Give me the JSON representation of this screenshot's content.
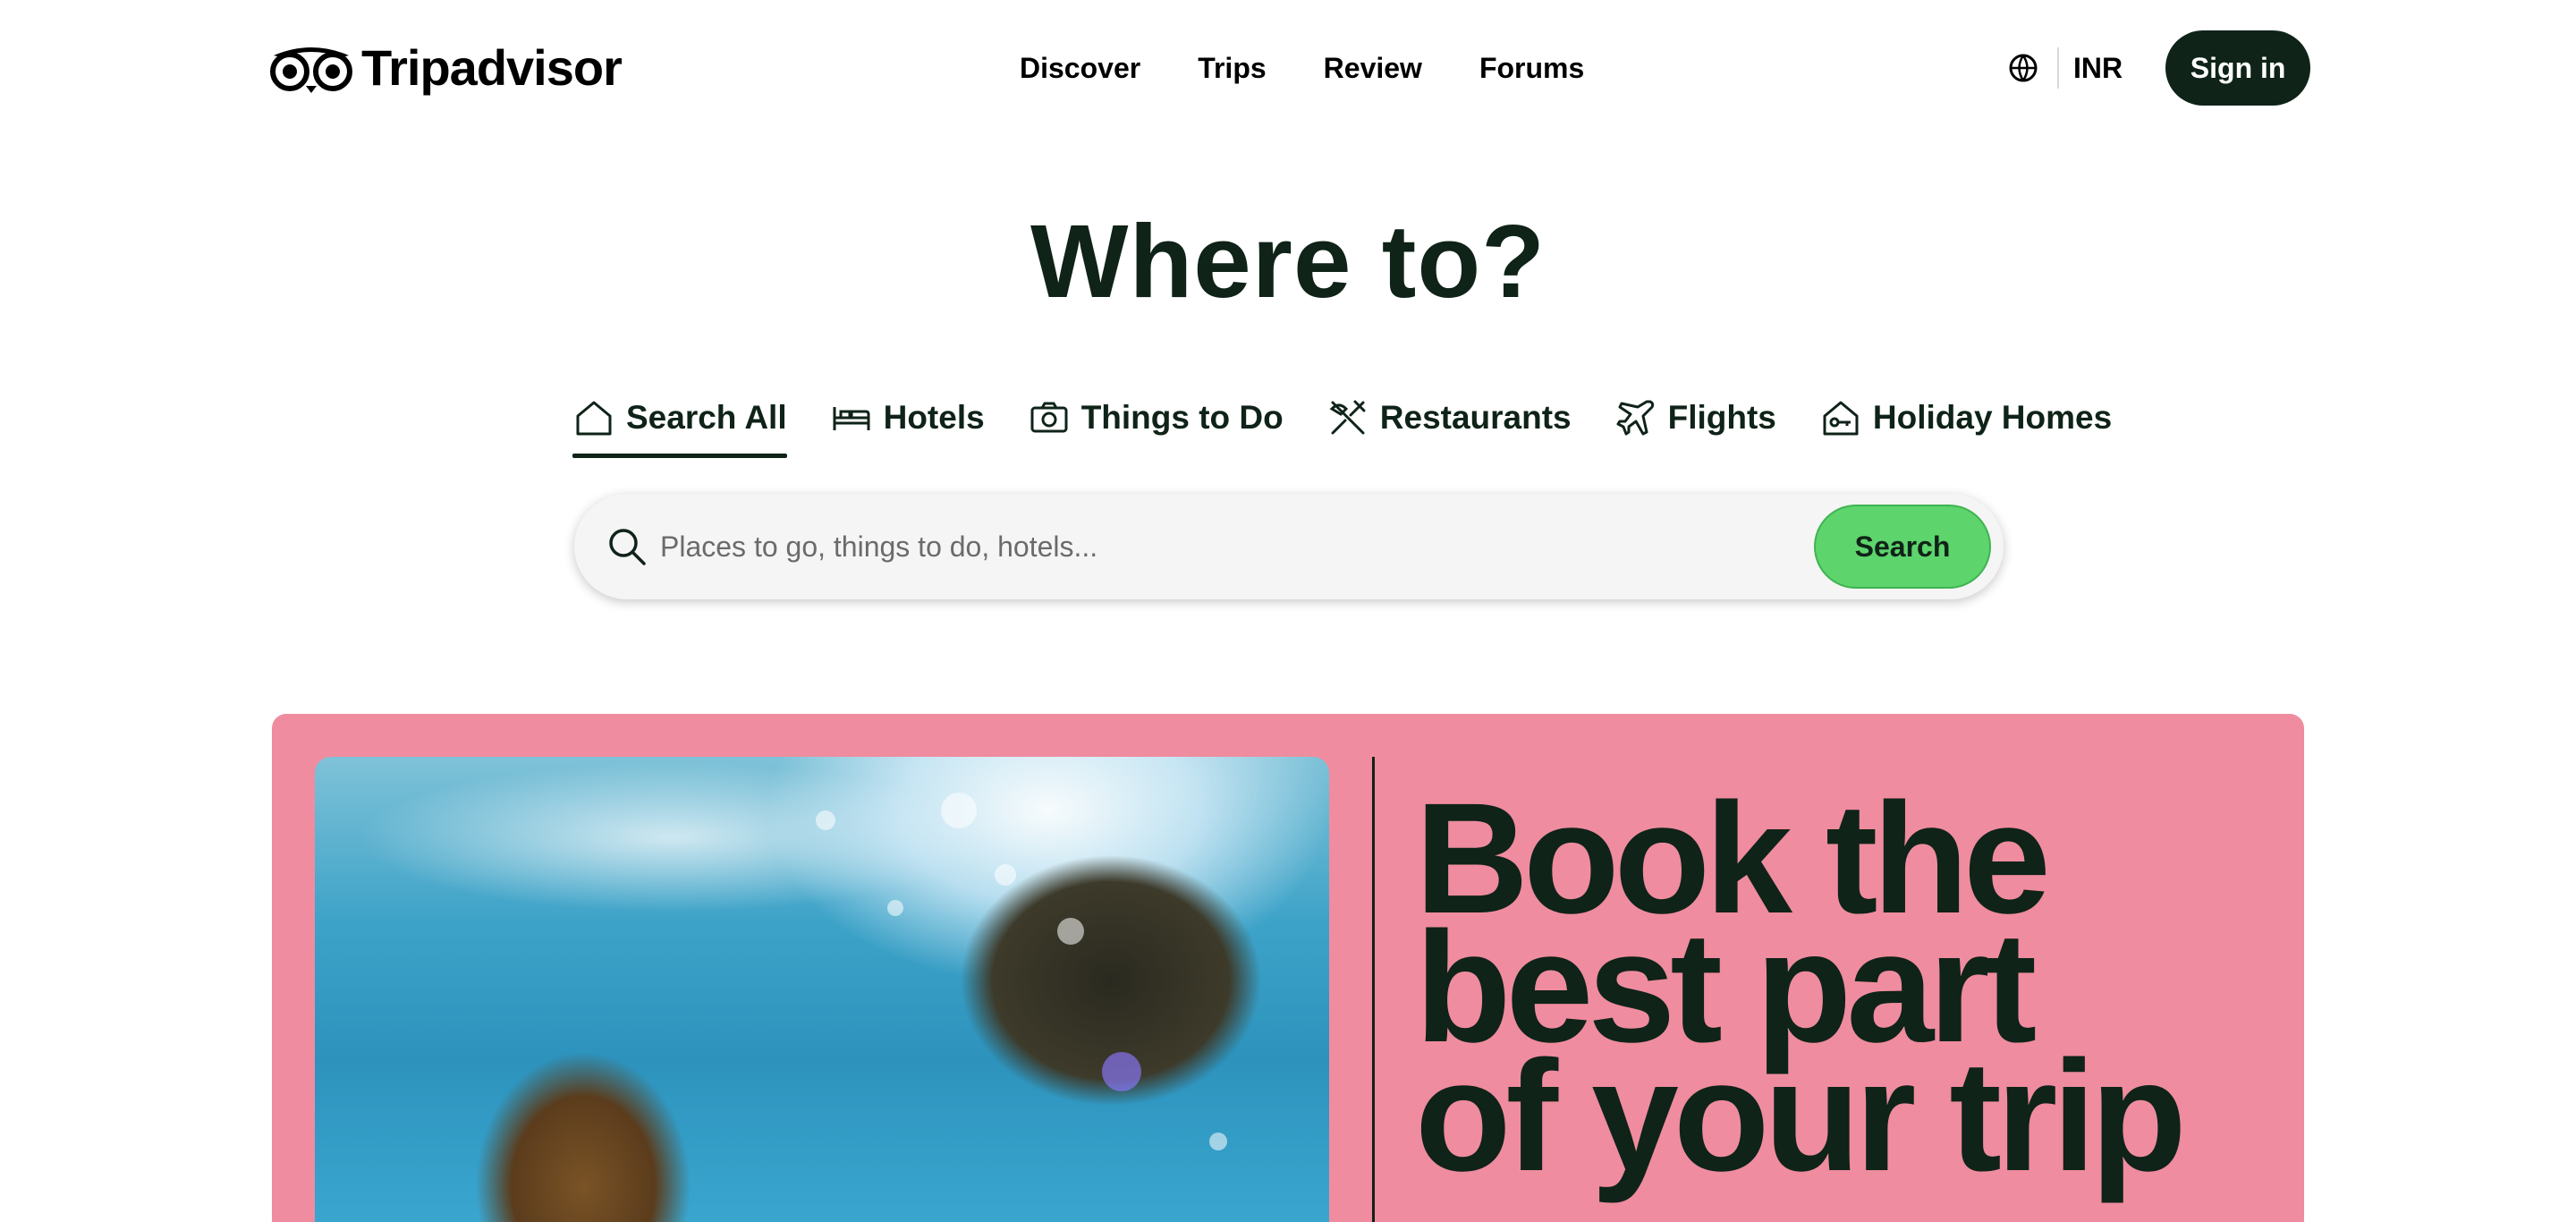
{
  "header": {
    "logo_text": "Tripadvisor",
    "nav": [
      "Discover",
      "Trips",
      "Review",
      "Forums"
    ],
    "currency": "INR",
    "signin_label": "Sign in"
  },
  "hero": {
    "title": "Where to?",
    "tabs": [
      {
        "label": "Search All",
        "icon": "home-icon",
        "active": true
      },
      {
        "label": "Hotels",
        "icon": "bed-icon"
      },
      {
        "label": "Things to Do",
        "icon": "camera-icon"
      },
      {
        "label": "Restaurants",
        "icon": "utensils-icon"
      },
      {
        "label": "Flights",
        "icon": "plane-icon"
      },
      {
        "label": "Holiday Homes",
        "icon": "house-key-icon"
      }
    ],
    "search": {
      "placeholder": "Places to go, things to do, hotels...",
      "button_label": "Search"
    }
  },
  "promo": {
    "headline_lines": [
      "Book the",
      "best part",
      "of your trip"
    ],
    "background_color": "#ef8c9f"
  },
  "colors": {
    "brand_dark": "#0f2318",
    "search_button": "#5ed46c"
  }
}
